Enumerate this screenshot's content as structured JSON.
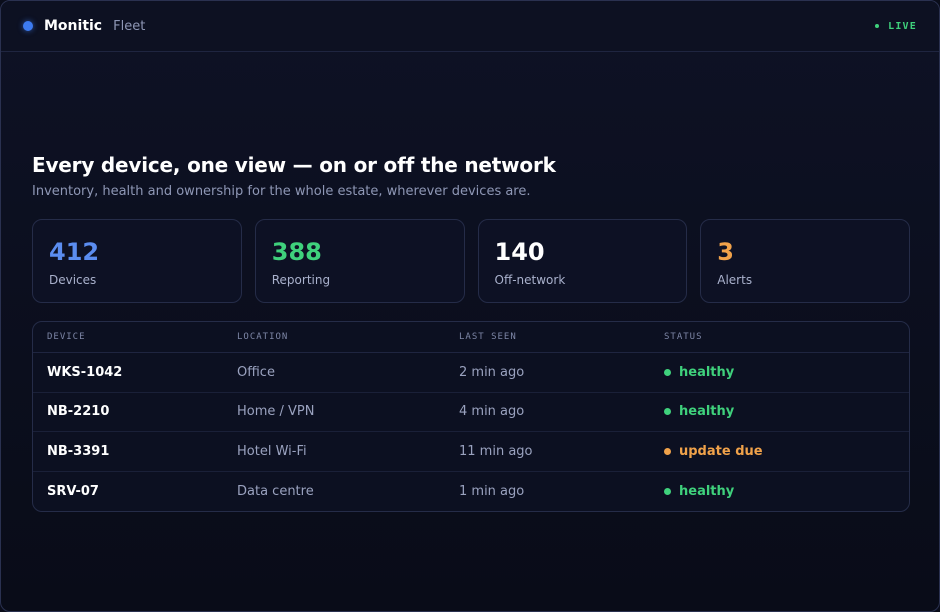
{
  "header": {
    "brand": "Monitic",
    "section": "Fleet",
    "live_label": "LIVE"
  },
  "hero": {
    "title": "Every device, one view — on or off the network",
    "subtitle": "Inventory, health and ownership for the whole estate, wherever devices are."
  },
  "stats": [
    {
      "value": "412",
      "label": "Devices",
      "color": "#5b8df0"
    },
    {
      "value": "388",
      "label": "Reporting",
      "color": "#3fd17c"
    },
    {
      "value": "140",
      "label": "Off-network",
      "color": "#ffffff"
    },
    {
      "value": "3",
      "label": "Alerts",
      "color": "#f0a24a"
    }
  ],
  "table": {
    "columns": [
      "DEVICE",
      "LOCATION",
      "LAST SEEN",
      "STATUS"
    ],
    "rows": [
      {
        "device": "WKS-1042",
        "location": "Office",
        "last_seen": "2 min ago",
        "status": "healthy",
        "status_color": "#3fd17c"
      },
      {
        "device": "NB-2210",
        "location": "Home / VPN",
        "last_seen": "4 min ago",
        "status": "healthy",
        "status_color": "#3fd17c"
      },
      {
        "device": "NB-3391",
        "location": "Hotel Wi-Fi",
        "last_seen": "11 min ago",
        "status": "update due",
        "status_color": "#f0a24a"
      },
      {
        "device": "SRV-07",
        "location": "Data centre",
        "last_seen": "1 min ago",
        "status": "healthy",
        "status_color": "#3fd17c"
      }
    ]
  },
  "colors": {
    "accent": "#3d7bf0",
    "healthy": "#3fd17c",
    "warning": "#f0a24a"
  }
}
